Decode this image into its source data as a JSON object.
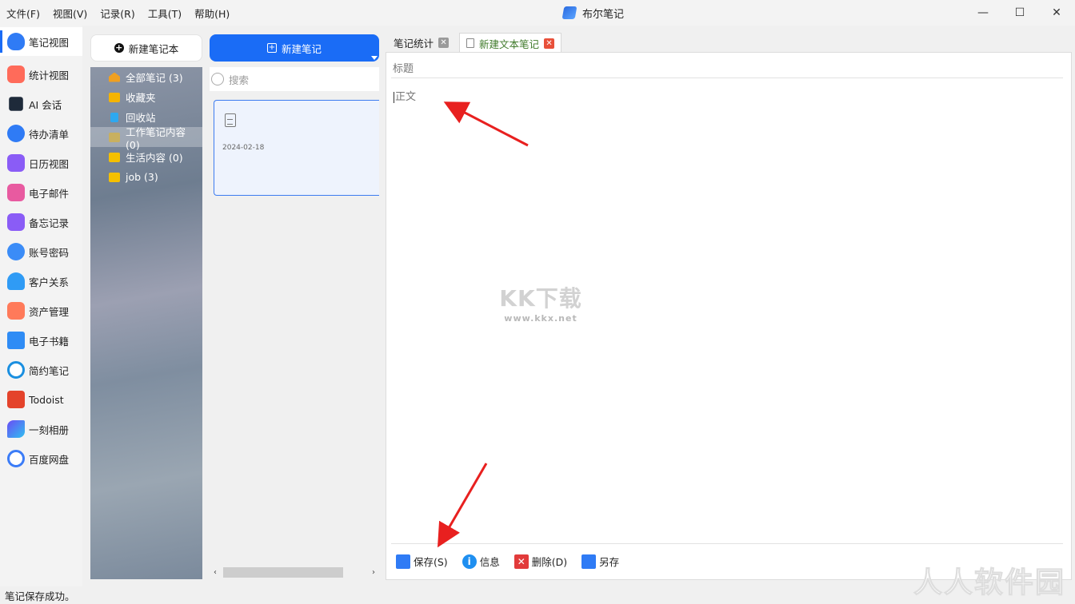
{
  "menu": [
    "文件(F)",
    "视图(V)",
    "记录(R)",
    "工具(T)",
    "帮助(H)"
  ],
  "app": {
    "title": "布尔笔记"
  },
  "window_controls": [
    "—",
    "☐",
    "✕"
  ],
  "sidebar": {
    "items": [
      {
        "label": "笔记视图",
        "icon": "cloud-note-icon",
        "color": "#2f7bf5"
      },
      {
        "label": "统计视图",
        "icon": "chart-icon",
        "color": "#ff6b5a"
      },
      {
        "label": "AI 会话",
        "icon": "robot-icon",
        "color": "#1e2a3a"
      },
      {
        "label": "待办清单",
        "icon": "todo-icon",
        "color": "#2f7bf5"
      },
      {
        "label": "日历视图",
        "icon": "calendar-icon",
        "color": "#8a5cf6"
      },
      {
        "label": "电子邮件",
        "icon": "mail-icon",
        "color": "#e85aa0"
      },
      {
        "label": "备忘记录",
        "icon": "memo-icon",
        "color": "#8a5cf6"
      },
      {
        "label": "账号密码",
        "icon": "password-icon",
        "color": "#3b8cf7"
      },
      {
        "label": "客户关系",
        "icon": "customer-icon",
        "color": "#2f9bf5"
      },
      {
        "label": "资产管理",
        "icon": "asset-icon",
        "color": "#ff7a5a"
      },
      {
        "label": "电子书籍",
        "icon": "ebook-icon",
        "color": "#2f8cf5"
      },
      {
        "label": "简约笔记",
        "icon": "simple-note-icon",
        "color": "#1a8fe0"
      },
      {
        "label": "Todoist",
        "icon": "todoist-icon",
        "color": "#e4432b"
      },
      {
        "label": "一刻相册",
        "icon": "album-icon",
        "color": "#6a4cf6"
      },
      {
        "label": "百度网盘",
        "icon": "netdisk-icon",
        "color": "#3b7cf7"
      }
    ]
  },
  "notebooks": {
    "new_label": "新建笔记本",
    "items": [
      {
        "label": "全部笔记 (3)",
        "icon": "home-icon",
        "color": "#f0a020"
      },
      {
        "label": "收藏夹",
        "icon": "favorites-icon",
        "color": "#f5b400"
      },
      {
        "label": "回收站",
        "icon": "trash-icon",
        "color": "#2ea8f0"
      },
      {
        "label": "工作笔记内容 (0)",
        "icon": "folder-icon",
        "color": "#c8b060"
      },
      {
        "label": "生活内容 (0)",
        "icon": "folder-icon",
        "color": "#f5c000"
      },
      {
        "label": "job (3)",
        "icon": "folder-icon",
        "color": "#f5c000"
      }
    ]
  },
  "notes": {
    "new_label": "新建笔记",
    "search_placeholder": "搜索",
    "items": [
      {
        "date": "2024-02-18"
      }
    ]
  },
  "tabs": [
    {
      "label": "笔记统计",
      "active": false
    },
    {
      "label": "新建文本笔记",
      "active": true
    }
  ],
  "editor": {
    "title_placeholder": "标题",
    "body_placeholder": "正文"
  },
  "actions": [
    {
      "label": "保存(S)",
      "icon": "save-icon",
      "color": "#2f7bf5"
    },
    {
      "label": "信息",
      "icon": "info-icon",
      "color": "#1f8ff0"
    },
    {
      "label": "删除(D)",
      "icon": "delete-icon",
      "color": "#e23b3b"
    },
    {
      "label": "另存",
      "icon": "save-as-icon",
      "color": "#2f7bf5"
    }
  ],
  "watermark": {
    "big": "KK下载",
    "small": "www.kkx.net"
  },
  "status": {
    "message": "笔记保存成功。"
  },
  "corner_watermark": "人人软件园",
  "accent": "#1a6cf6",
  "annotation_color": "#e8201f"
}
